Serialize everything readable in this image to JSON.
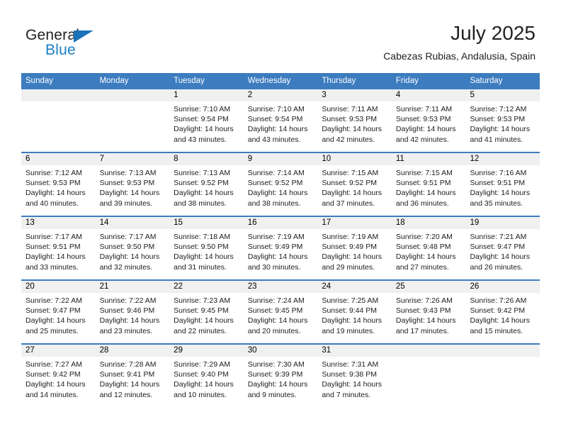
{
  "brand": {
    "name_top": "General",
    "name_bottom": "Blue",
    "triangle_color": "#1a73ba",
    "blue_color": "#1a7ec4"
  },
  "header": {
    "month_title": "July 2025",
    "location": "Cabezas Rubias, Andalusia, Spain"
  },
  "colors": {
    "header_blue": "#3c7cbf",
    "day_strip_gray": "#f0f0f0",
    "cell_white": "#ffffff"
  },
  "weekdays": [
    "Sunday",
    "Monday",
    "Tuesday",
    "Wednesday",
    "Thursday",
    "Friday",
    "Saturday"
  ],
  "weeks": [
    [
      {
        "day": "",
        "empty": true,
        "sunrise": "",
        "sunset": "",
        "daylight_line1": "",
        "daylight_line2": ""
      },
      {
        "day": "",
        "empty": true,
        "sunrise": "",
        "sunset": "",
        "daylight_line1": "",
        "daylight_line2": ""
      },
      {
        "day": "1",
        "empty": false,
        "sunrise": "Sunrise: 7:10 AM",
        "sunset": "Sunset: 9:54 PM",
        "daylight_line1": "Daylight: 14 hours",
        "daylight_line2": "and 43 minutes."
      },
      {
        "day": "2",
        "empty": false,
        "sunrise": "Sunrise: 7:10 AM",
        "sunset": "Sunset: 9:54 PM",
        "daylight_line1": "Daylight: 14 hours",
        "daylight_line2": "and 43 minutes."
      },
      {
        "day": "3",
        "empty": false,
        "sunrise": "Sunrise: 7:11 AM",
        "sunset": "Sunset: 9:53 PM",
        "daylight_line1": "Daylight: 14 hours",
        "daylight_line2": "and 42 minutes."
      },
      {
        "day": "4",
        "empty": false,
        "sunrise": "Sunrise: 7:11 AM",
        "sunset": "Sunset: 9:53 PM",
        "daylight_line1": "Daylight: 14 hours",
        "daylight_line2": "and 42 minutes."
      },
      {
        "day": "5",
        "empty": false,
        "sunrise": "Sunrise: 7:12 AM",
        "sunset": "Sunset: 9:53 PM",
        "daylight_line1": "Daylight: 14 hours",
        "daylight_line2": "and 41 minutes."
      }
    ],
    [
      {
        "day": "6",
        "empty": false,
        "sunrise": "Sunrise: 7:12 AM",
        "sunset": "Sunset: 9:53 PM",
        "daylight_line1": "Daylight: 14 hours",
        "daylight_line2": "and 40 minutes."
      },
      {
        "day": "7",
        "empty": false,
        "sunrise": "Sunrise: 7:13 AM",
        "sunset": "Sunset: 9:53 PM",
        "daylight_line1": "Daylight: 14 hours",
        "daylight_line2": "and 39 minutes."
      },
      {
        "day": "8",
        "empty": false,
        "sunrise": "Sunrise: 7:13 AM",
        "sunset": "Sunset: 9:52 PM",
        "daylight_line1": "Daylight: 14 hours",
        "daylight_line2": "and 38 minutes."
      },
      {
        "day": "9",
        "empty": false,
        "sunrise": "Sunrise: 7:14 AM",
        "sunset": "Sunset: 9:52 PM",
        "daylight_line1": "Daylight: 14 hours",
        "daylight_line2": "and 38 minutes."
      },
      {
        "day": "10",
        "empty": false,
        "sunrise": "Sunrise: 7:15 AM",
        "sunset": "Sunset: 9:52 PM",
        "daylight_line1": "Daylight: 14 hours",
        "daylight_line2": "and 37 minutes."
      },
      {
        "day": "11",
        "empty": false,
        "sunrise": "Sunrise: 7:15 AM",
        "sunset": "Sunset: 9:51 PM",
        "daylight_line1": "Daylight: 14 hours",
        "daylight_line2": "and 36 minutes."
      },
      {
        "day": "12",
        "empty": false,
        "sunrise": "Sunrise: 7:16 AM",
        "sunset": "Sunset: 9:51 PM",
        "daylight_line1": "Daylight: 14 hours",
        "daylight_line2": "and 35 minutes."
      }
    ],
    [
      {
        "day": "13",
        "empty": false,
        "sunrise": "Sunrise: 7:17 AM",
        "sunset": "Sunset: 9:51 PM",
        "daylight_line1": "Daylight: 14 hours",
        "daylight_line2": "and 33 minutes."
      },
      {
        "day": "14",
        "empty": false,
        "sunrise": "Sunrise: 7:17 AM",
        "sunset": "Sunset: 9:50 PM",
        "daylight_line1": "Daylight: 14 hours",
        "daylight_line2": "and 32 minutes."
      },
      {
        "day": "15",
        "empty": false,
        "sunrise": "Sunrise: 7:18 AM",
        "sunset": "Sunset: 9:50 PM",
        "daylight_line1": "Daylight: 14 hours",
        "daylight_line2": "and 31 minutes."
      },
      {
        "day": "16",
        "empty": false,
        "sunrise": "Sunrise: 7:19 AM",
        "sunset": "Sunset: 9:49 PM",
        "daylight_line1": "Daylight: 14 hours",
        "daylight_line2": "and 30 minutes."
      },
      {
        "day": "17",
        "empty": false,
        "sunrise": "Sunrise: 7:19 AM",
        "sunset": "Sunset: 9:49 PM",
        "daylight_line1": "Daylight: 14 hours",
        "daylight_line2": "and 29 minutes."
      },
      {
        "day": "18",
        "empty": false,
        "sunrise": "Sunrise: 7:20 AM",
        "sunset": "Sunset: 9:48 PM",
        "daylight_line1": "Daylight: 14 hours",
        "daylight_line2": "and 27 minutes."
      },
      {
        "day": "19",
        "empty": false,
        "sunrise": "Sunrise: 7:21 AM",
        "sunset": "Sunset: 9:47 PM",
        "daylight_line1": "Daylight: 14 hours",
        "daylight_line2": "and 26 minutes."
      }
    ],
    [
      {
        "day": "20",
        "empty": false,
        "sunrise": "Sunrise: 7:22 AM",
        "sunset": "Sunset: 9:47 PM",
        "daylight_line1": "Daylight: 14 hours",
        "daylight_line2": "and 25 minutes."
      },
      {
        "day": "21",
        "empty": false,
        "sunrise": "Sunrise: 7:22 AM",
        "sunset": "Sunset: 9:46 PM",
        "daylight_line1": "Daylight: 14 hours",
        "daylight_line2": "and 23 minutes."
      },
      {
        "day": "22",
        "empty": false,
        "sunrise": "Sunrise: 7:23 AM",
        "sunset": "Sunset: 9:45 PM",
        "daylight_line1": "Daylight: 14 hours",
        "daylight_line2": "and 22 minutes."
      },
      {
        "day": "23",
        "empty": false,
        "sunrise": "Sunrise: 7:24 AM",
        "sunset": "Sunset: 9:45 PM",
        "daylight_line1": "Daylight: 14 hours",
        "daylight_line2": "and 20 minutes."
      },
      {
        "day": "24",
        "empty": false,
        "sunrise": "Sunrise: 7:25 AM",
        "sunset": "Sunset: 9:44 PM",
        "daylight_line1": "Daylight: 14 hours",
        "daylight_line2": "and 19 minutes."
      },
      {
        "day": "25",
        "empty": false,
        "sunrise": "Sunrise: 7:26 AM",
        "sunset": "Sunset: 9:43 PM",
        "daylight_line1": "Daylight: 14 hours",
        "daylight_line2": "and 17 minutes."
      },
      {
        "day": "26",
        "empty": false,
        "sunrise": "Sunrise: 7:26 AM",
        "sunset": "Sunset: 9:42 PM",
        "daylight_line1": "Daylight: 14 hours",
        "daylight_line2": "and 15 minutes."
      }
    ],
    [
      {
        "day": "27",
        "empty": false,
        "sunrise": "Sunrise: 7:27 AM",
        "sunset": "Sunset: 9:42 PM",
        "daylight_line1": "Daylight: 14 hours",
        "daylight_line2": "and 14 minutes."
      },
      {
        "day": "28",
        "empty": false,
        "sunrise": "Sunrise: 7:28 AM",
        "sunset": "Sunset: 9:41 PM",
        "daylight_line1": "Daylight: 14 hours",
        "daylight_line2": "and 12 minutes."
      },
      {
        "day": "29",
        "empty": false,
        "sunrise": "Sunrise: 7:29 AM",
        "sunset": "Sunset: 9:40 PM",
        "daylight_line1": "Daylight: 14 hours",
        "daylight_line2": "and 10 minutes."
      },
      {
        "day": "30",
        "empty": false,
        "sunrise": "Sunrise: 7:30 AM",
        "sunset": "Sunset: 9:39 PM",
        "daylight_line1": "Daylight: 14 hours",
        "daylight_line2": "and 9 minutes."
      },
      {
        "day": "31",
        "empty": false,
        "sunrise": "Sunrise: 7:31 AM",
        "sunset": "Sunset: 9:38 PM",
        "daylight_line1": "Daylight: 14 hours",
        "daylight_line2": "and 7 minutes."
      },
      {
        "day": "",
        "empty": true,
        "sunrise": "",
        "sunset": "",
        "daylight_line1": "",
        "daylight_line2": ""
      },
      {
        "day": "",
        "empty": true,
        "sunrise": "",
        "sunset": "",
        "daylight_line1": "",
        "daylight_line2": ""
      }
    ]
  ]
}
